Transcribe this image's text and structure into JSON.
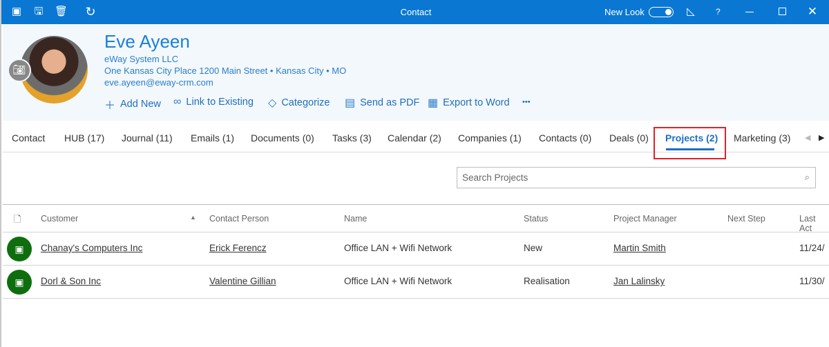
{
  "window": {
    "title": "Contact",
    "new_look_label": "New Look",
    "new_look_on": true,
    "help": "?",
    "accent": "#0a78d2"
  },
  "contact": {
    "name": "Eve Ayeen",
    "company": "eWay System LLC",
    "address": "One Kansas City Place 1200 Main Street",
    "city": "Kansas City",
    "state": "MO",
    "email": "eve.ayeen@eway-crm.com"
  },
  "actions": {
    "add_new": "Add New",
    "link_existing": "Link to Existing",
    "categorize": "Categorize",
    "send_pdf": "Send as PDF",
    "export_word": "Export to Word",
    "more": "•••"
  },
  "tabs": [
    "Contact",
    "HUB (17)",
    "Journal (11)",
    "Emails (1)",
    "Documents (0)",
    "Tasks (3)",
    "Calendar (2)",
    "Companies (1)",
    "Contacts (0)",
    "Deals (0)",
    "Projects (2)",
    "Marketing (3)"
  ],
  "active_tab": "Projects (2)",
  "search": {
    "placeholder": "Search Projects"
  },
  "table": {
    "columns": [
      "Customer",
      "Contact Person",
      "Name",
      "Status",
      "Project Manager",
      "Next Step",
      "Last Act"
    ],
    "sort": {
      "column": "Customer",
      "direction": "ascending"
    },
    "rows": [
      {
        "customer": "Chanay's Computers Inc",
        "contact": "Erick Ferencz",
        "name": "Office LAN + Wifi Network",
        "status": "New",
        "manager": "Martin Smith",
        "next_step": "",
        "last_activity": "11/24/"
      },
      {
        "customer": "Dorl & Son Inc",
        "contact": "Valentine Gillian",
        "name": "Office LAN + Wifi Network",
        "status": "Realisation",
        "manager": "Jan Lalinsky",
        "next_step": "",
        "last_activity": "11/30/"
      }
    ]
  }
}
